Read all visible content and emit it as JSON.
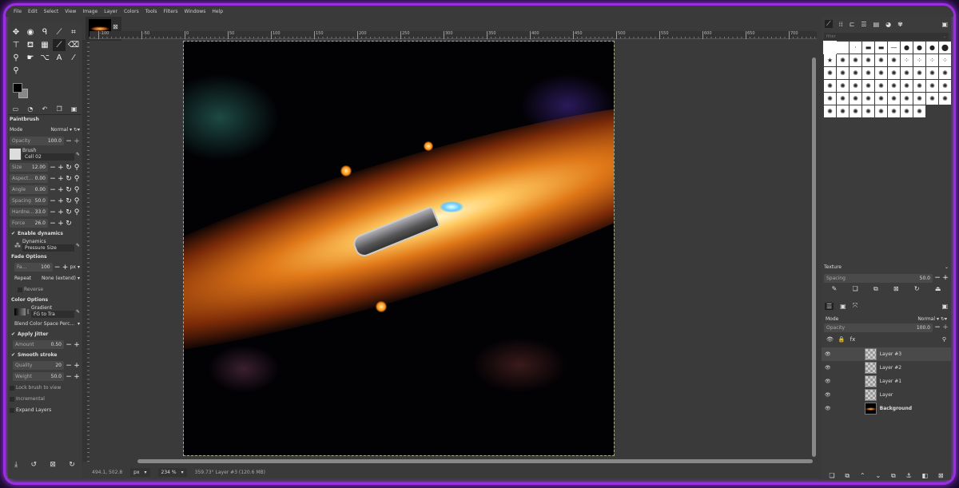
{
  "menu": [
    "File",
    "Edit",
    "Select",
    "View",
    "Image",
    "Layer",
    "Colors",
    "Tools",
    "Filters",
    "Windows",
    "Help"
  ],
  "tools": [
    "move-icon",
    "ellipse-select-icon",
    "free-select-icon",
    "fuzzy-select-icon",
    "crop-icon",
    "transform-icon",
    "bucket-fill-icon",
    "pattern-icon",
    "paintbrush-icon",
    "eraser-icon",
    "clone-icon",
    "smudge-icon",
    "paths-icon",
    "text-icon",
    "color-picker-icon",
    "zoom-icon"
  ],
  "tool_options": {
    "title": "Paintbrush",
    "mode_label": "Mode",
    "mode_value": "Normal",
    "opacity_label": "Opacity",
    "opacity_value": "100.0",
    "brush_label": "Brush",
    "brush_value": "Cell 02",
    "sliders": [
      {
        "label": "Size",
        "value": "12.00"
      },
      {
        "label": "Aspect...",
        "value": "0.00"
      },
      {
        "label": "Angle",
        "value": "0.00"
      },
      {
        "label": "Spacing",
        "value": "50.0"
      },
      {
        "label": "Hardne...",
        "value": "33.0"
      },
      {
        "label": "Force",
        "value": "26.0"
      }
    ],
    "enable_dynamics": "Enable dynamics",
    "dynamics_label": "Dynamics",
    "dynamics_value": "Pressure Size",
    "fade_options": "Fade Options",
    "fade_label": "Fa...",
    "fade_value": "100",
    "fade_unit": "px",
    "repeat_label": "Repeat",
    "repeat_value": "None (extend)",
    "reverse": "Reverse",
    "color_options": "Color Options",
    "gradient_label": "Gradient",
    "gradient_value": "FG to Tra",
    "blend_value": "Blend Color Space Perc...",
    "apply_jitter": "Apply Jitter",
    "amount_label": "Amount",
    "amount_value": "0.50",
    "smooth_stroke": "Smooth stroke",
    "quality_label": "Quality",
    "quality_value": "20",
    "weight_label": "Weight",
    "weight_value": "50.0",
    "lock_brush": "Lock brush to view",
    "incremental": "Incremental",
    "expand_layers": "Expand Layers"
  },
  "ruler_labels": [
    "-100",
    "-50",
    "0",
    "50",
    "100",
    "150",
    "200",
    "250",
    "300",
    "350",
    "400",
    "450",
    "500",
    "550",
    "600",
    "650",
    "700"
  ],
  "status": {
    "coords": "494.1, 502.8",
    "unit": "px",
    "zoom": "234 %",
    "info": "359.73° Layer #3 (120.6 MB)"
  },
  "right_panel": {
    "filter_placeholder": "filter",
    "brush_count": 58,
    "texture_label": "Texture",
    "spacing_label": "Spacing",
    "spacing_value": "50.0",
    "mode_label": "Mode",
    "mode_value": "Normal",
    "opacity_label": "Opacity",
    "opacity_value": "100.0",
    "layers": [
      {
        "name": "Layer #3",
        "selected": true
      },
      {
        "name": "Layer #2"
      },
      {
        "name": "Layer #1"
      },
      {
        "name": "Layer"
      },
      {
        "name": "Background",
        "bold": true
      }
    ]
  }
}
